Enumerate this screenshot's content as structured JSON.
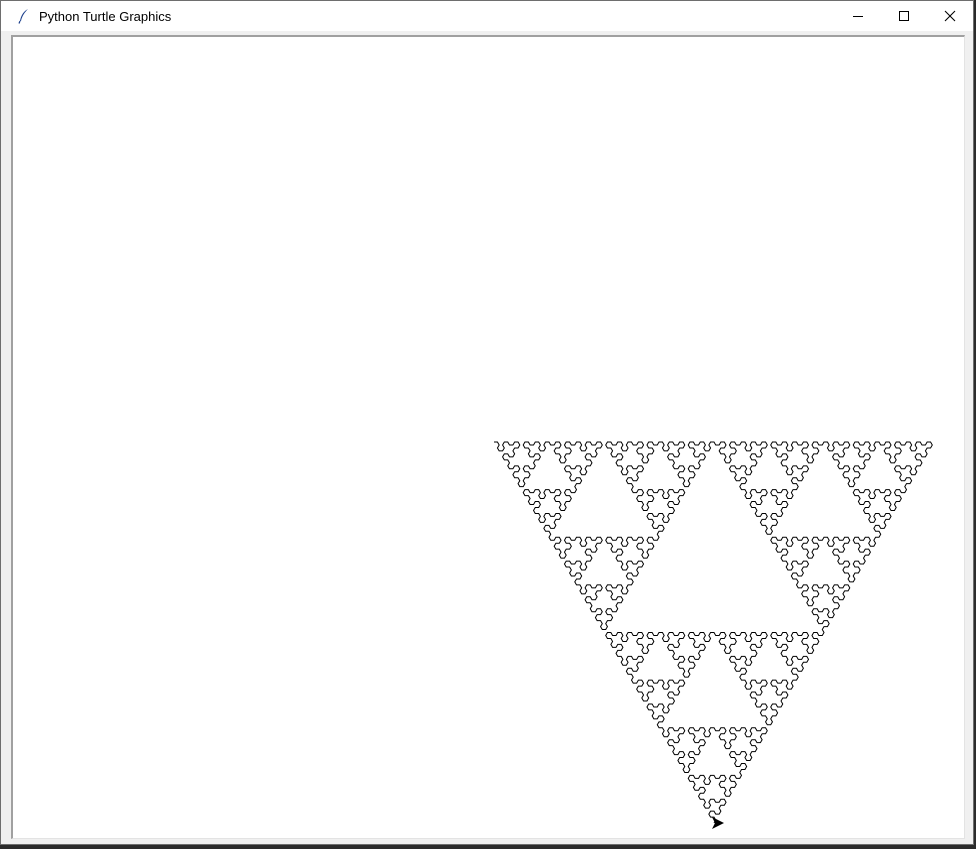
{
  "window": {
    "title": "Python Turtle Graphics",
    "controls": {
      "minimize_icon": "minimize-icon",
      "maximize_icon": "maximize-icon",
      "close_icon": "close-icon"
    }
  },
  "canvas": {
    "background": "#ffffff",
    "pen_color": "#000000",
    "drawing": "sierpinski-arrowhead-curve",
    "turtle_icon": "arrow-turtle-icon"
  }
}
